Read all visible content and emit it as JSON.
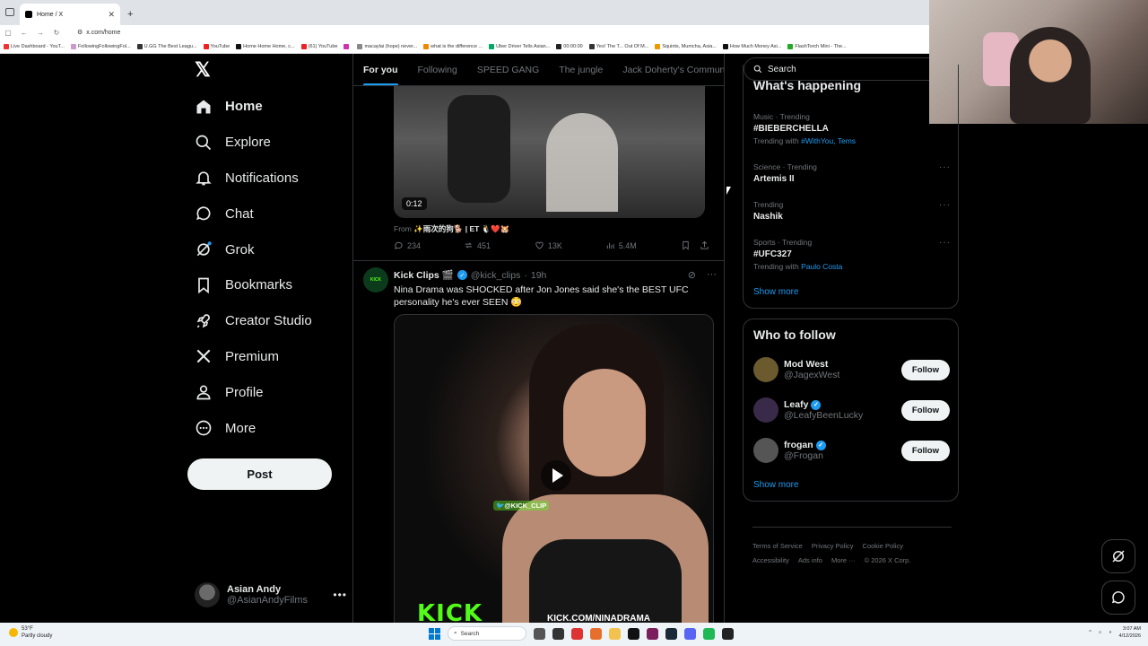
{
  "browser": {
    "tab_title": "Home / X",
    "url": "x.com/home",
    "bookmarks": [
      "Live Dashboard - YouT...",
      "FollowingFollowingFol...",
      "U.GG The Best Leagu...",
      "YouTube",
      "Home Home Home, c...",
      "(61) YouTube",
      "",
      "macaylai (hope) never...",
      "what is the difference ...",
      "Uber Driver Tells Asian...",
      "00:00:00",
      "Yes! The T... Out Of M...",
      "Squints, Mumcha, Asia...",
      "How Much Money Asi...",
      "FlashTorch Mini - The..."
    ]
  },
  "nav": {
    "items": [
      {
        "label": "Home",
        "icon": "home-icon",
        "active": true
      },
      {
        "label": "Explore",
        "icon": "search-icon"
      },
      {
        "label": "Notifications",
        "icon": "bell-icon"
      },
      {
        "label": "Chat",
        "icon": "chat-icon"
      },
      {
        "label": "Grok",
        "icon": "grok-icon"
      },
      {
        "label": "Bookmarks",
        "icon": "bookmark-icon"
      },
      {
        "label": "Creator Studio",
        "icon": "rocket-icon"
      },
      {
        "label": "Premium",
        "icon": "x-logo-icon"
      },
      {
        "label": "Profile",
        "icon": "person-icon"
      },
      {
        "label": "More",
        "icon": "more-circle-icon"
      }
    ],
    "post_label": "Post",
    "account": {
      "display_name": "Asian Andy",
      "handle": "@AsianAndyFilms"
    }
  },
  "feed": {
    "tabs": [
      "For you",
      "Following",
      "SPEED GANG",
      "The jungle",
      "Jack Doherty's Commun"
    ],
    "tweet1": {
      "duration": "0:12",
      "from_label": "From",
      "from_name": "✨雨次的狗🐕 | ET 🐧❤️🐹",
      "replies": "234",
      "reposts": "451",
      "likes": "13K",
      "views": "5.4M"
    },
    "tweet2": {
      "name": "Kick Clips 🎬",
      "handle": "@kick_clips",
      "time": "19h",
      "text": "Nina Drama was SHOCKED after Jon Jones said she's the BEST UFC personality he's ever SEEN 😳",
      "video_tag": "🐦@KICK_CLIP",
      "video_logo": "KICK",
      "video_url": "KICK.COM/NINADRAMA"
    }
  },
  "sidebar": {
    "search_placeholder": "Search",
    "trends_title": "What's happening",
    "trends": [
      {
        "meta": "Music · Trending",
        "title": "#BIEBERCHELLA",
        "with_label": "Trending with",
        "with": "#WithYou, Tems"
      },
      {
        "meta": "Science · Trending",
        "title": "Artemis II"
      },
      {
        "meta": "Trending",
        "title": "Nashik"
      },
      {
        "meta": "Sports · Trending",
        "title": "#UFC327",
        "with_label": "Trending with",
        "with": "Paulo Costa"
      }
    ],
    "show_more": "Show more",
    "who_to_follow_title": "Who to follow",
    "follow": [
      {
        "name": "Mod West",
        "handle": "@JagexWest",
        "verified": false
      },
      {
        "name": "Leafy",
        "handle": "@LeafyBeenLucky",
        "verified": true
      },
      {
        "name": "frogan",
        "handle": "@Frogan",
        "verified": true
      }
    ],
    "follow_label": "Follow",
    "footer": [
      "Terms of Service",
      "Privacy Policy",
      "Cookie Policy",
      "Accessibility",
      "Ads info",
      "More ···",
      "© 2026 X Corp."
    ]
  },
  "taskbar": {
    "weather_temp": "53°F",
    "weather_desc": "Partly cloudy",
    "search": "Search",
    "time": "3:07 AM",
    "date": "4/12/2026"
  },
  "colors": {
    "accent": "#1d9bf0",
    "kick_green": "#53fc18",
    "background": "#000000"
  }
}
